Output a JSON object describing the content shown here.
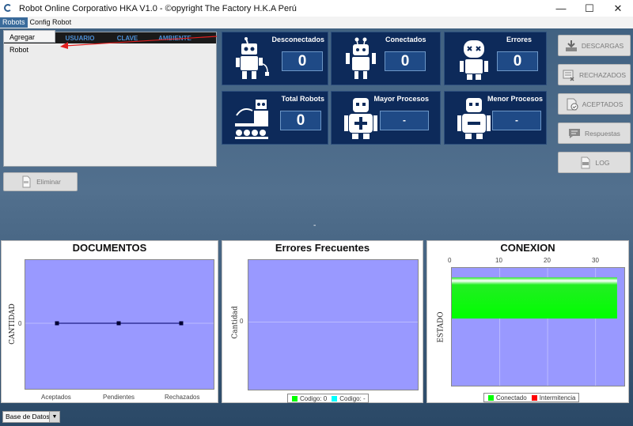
{
  "window": {
    "title": "Robot Online Corporativo HKA V1.0  - ©opyright The Factory H.K.A Perú"
  },
  "controls": {
    "minimize": "—",
    "maximize": "☐",
    "close": "✕"
  },
  "menu": {
    "robots": "Robots",
    "config": "Config Robot",
    "dropdown_item": "Agregar Robot"
  },
  "table": {
    "headers": [
      "USUARIO",
      "CLAVE",
      "AMBIENTE"
    ]
  },
  "buttons": {
    "eliminar": "Eliminar",
    "descargas": "DESCARGAS",
    "rechazados": "RECHAZADOS",
    "aceptados": "ACEPTADOS",
    "respuestas": "Respuestas",
    "log": "LOG"
  },
  "stats": {
    "desconectados": {
      "label": "Desconectados",
      "value": "0"
    },
    "conectados": {
      "label": "Conectados",
      "value": "0"
    },
    "errores": {
      "label": "Errores",
      "value": "0"
    },
    "total": {
      "label": "Total Robots",
      "value": "0"
    },
    "mayor": {
      "label": "Mayor Procesos",
      "value": "-"
    },
    "menor": {
      "label": "Menor Procesos",
      "value": "-"
    }
  },
  "center_mark": "-",
  "charts": {
    "documentos": {
      "title": "DOCUMENTOS",
      "ylabel": "CANTIDAD",
      "ytick": "0",
      "categories": [
        "Aceptados",
        "Pendientes",
        "Rechazados"
      ]
    },
    "errores": {
      "title": "Errores Frecuentes",
      "ylabel": "Cantidad",
      "ytick": "0",
      "legend": [
        "Codigo: 0",
        "Codigo: -"
      ]
    },
    "conexion": {
      "title": "CONEXION",
      "ylabel": "ESTADO",
      "xticks": [
        "0",
        "10",
        "20",
        "30"
      ],
      "legend": [
        "Conectado",
        "Intermitencia"
      ]
    }
  },
  "chart_data": [
    {
      "type": "line",
      "title": "DOCUMENTOS",
      "ylabel": "CANTIDAD",
      "categories": [
        "Aceptados",
        "Pendientes",
        "Rechazados"
      ],
      "values": [
        0,
        0,
        0
      ]
    },
    {
      "type": "bar",
      "title": "Errores Frecuentes",
      "ylabel": "Cantidad",
      "series": [
        {
          "name": "Codigo: 0",
          "values": []
        },
        {
          "name": "Codigo: -",
          "values": []
        }
      ]
    },
    {
      "type": "bar",
      "title": "CONEXION",
      "ylabel": "ESTADO",
      "orientation": "horizontal",
      "xlim": [
        0,
        36
      ],
      "series": [
        {
          "name": "Conectado",
          "values": [
            34.5
          ]
        },
        {
          "name": "Intermitencia",
          "values": [
            0
          ]
        }
      ]
    }
  ],
  "colors": {
    "stat_bg": "#0d2a5a",
    "plot_bg": "#9999ff",
    "conectado": "#00ff00",
    "intermitencia": "#ff0000",
    "codigo0": "#00ff00",
    "codigo1": "#00ffff"
  },
  "footer": {
    "select_value": "Base de Datos"
  }
}
